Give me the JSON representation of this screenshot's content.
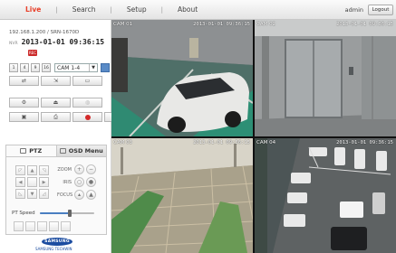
{
  "nav": {
    "items": [
      "Live",
      "Search",
      "Setup",
      "About"
    ],
    "active": "Live",
    "separator": "|",
    "user": "admin",
    "logout": "Logout"
  },
  "device": {
    "info": "192.168.1.200 / SRN-1670D",
    "date_label": "NVR",
    "datetime": "2013-01-01 09:36:15",
    "rec_label": "REC"
  },
  "split": {
    "buttons": [
      "1",
      "4",
      "9",
      "16"
    ],
    "camera_select": "CAM 1-4"
  },
  "ptz": {
    "tab_ptz": "PTZ",
    "tab_osd": "OSD Menu",
    "zoom": "ZOOM",
    "iris": "IRIS",
    "focus": "FOCUS",
    "speed_label": "PT Speed",
    "speed_level": 0.55
  },
  "logo": {
    "brand": "SAMSUNG",
    "sub": "SAMSUNG TECHWIN"
  },
  "cameras": [
    {
      "name": "CAM 01",
      "timestamp": "2013-01-01 09:36:15"
    },
    {
      "name": "CAM 02",
      "timestamp": "2013-01-01 09:36:15"
    },
    {
      "name": "CAM 03",
      "timestamp": "2013-01-01 09:36:15"
    },
    {
      "name": "CAM 04",
      "timestamp": "2013-01-01 09:36:15"
    }
  ],
  "colors": {
    "accent": "#e8402a",
    "brand": "#1b4ca0"
  }
}
